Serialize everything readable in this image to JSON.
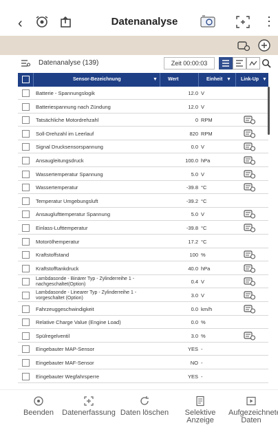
{
  "header": {
    "title": "Datenanalyse",
    "back_icon": "chevron-left-icon",
    "more_icon": "more-vertical-icon"
  },
  "titlebar": {
    "title": "Datenanalyse (139)",
    "time": "Zeit 00:00:03"
  },
  "table": {
    "headers": {
      "name": "Sensor-Bezeichnung",
      "value": "Wert",
      "unit": "Einheit",
      "link": "Link-Up"
    },
    "rows": [
      {
        "name": "Batterie - Spannungslogik",
        "value": "12.0",
        "unit": "V",
        "link": false
      },
      {
        "name": "Batteriespannung nach Zündung",
        "value": "12.0",
        "unit": "V",
        "link": false
      },
      {
        "name": "Tatsächliche Motordrehzahl",
        "value": "0",
        "unit": "RPM",
        "link": true
      },
      {
        "name": "Soll-Drehzahl im Leerlauf",
        "value": "820",
        "unit": "RPM",
        "link": true
      },
      {
        "name": "Signal Drucksensorspannung",
        "value": "0.0",
        "unit": "V",
        "link": true
      },
      {
        "name": "Ansaugleitungsdruck",
        "value": "100.0",
        "unit": "hPa",
        "link": true
      },
      {
        "name": "Wassertemperatur Spannung",
        "value": "5.0",
        "unit": "V",
        "link": true
      },
      {
        "name": "Wassertemperatur",
        "value": "-39.8",
        "unit": "°C",
        "link": true
      },
      {
        "name": "Temperatur Umgebungsluft",
        "value": "-39.2",
        "unit": "°C",
        "link": false
      },
      {
        "name": "Ansauglufttemperatur Spannung",
        "value": "5.0",
        "unit": "V",
        "link": true
      },
      {
        "name": "Einlass-Lufttemperatur",
        "value": "-39.8",
        "unit": "°C",
        "link": true
      },
      {
        "name": "Motorölhemperatur",
        "value": "17.2",
        "unit": "°C",
        "link": false
      },
      {
        "name": "Kraftstoffstand",
        "value": "100",
        "unit": "%",
        "link": true
      },
      {
        "name": "Kraftstofftankdruck",
        "value": "40.0",
        "unit": "hPa",
        "link": true
      },
      {
        "name": "Lambdasonde - Binärer Typ - Zylinderreihe 1 - nachgeschaltet(Option)",
        "value": "0.4",
        "unit": "V",
        "link": true
      },
      {
        "name": "Lambdasonde - Linearer Typ - Zylinderreihe 1 - vorgeschaltet (Option)",
        "value": "3.0",
        "unit": "V",
        "link": true
      },
      {
        "name": "Fahrzeuggeschwindigkeit",
        "value": "0.0",
        "unit": "km/h",
        "link": true
      },
      {
        "name": "Relative Charge Value (Engine Load)",
        "value": "0.0",
        "unit": "%",
        "link": false
      },
      {
        "name": "Spülregelventil",
        "value": "3.0",
        "unit": "%",
        "link": true
      },
      {
        "name": "Eingebauter MAP-Sensor",
        "value": "YES",
        "unit": "-",
        "link": false
      },
      {
        "name": "Eingebauter MAF-Sensor",
        "value": "NO",
        "unit": "-",
        "link": false
      },
      {
        "name": "Eingebauter Wegfahrsperre",
        "value": "YES",
        "unit": "-",
        "link": false
      }
    ]
  },
  "bottombar": {
    "buttons": [
      {
        "label": "Beenden"
      },
      {
        "label": "Datenerfassung"
      },
      {
        "label": "Daten löschen"
      },
      {
        "label": "Selektive Anzeige"
      },
      {
        "label": "Aufgezeichnete Daten"
      }
    ]
  },
  "colors": {
    "accent": "#1e3f86",
    "subbar": "#e4dbce"
  }
}
